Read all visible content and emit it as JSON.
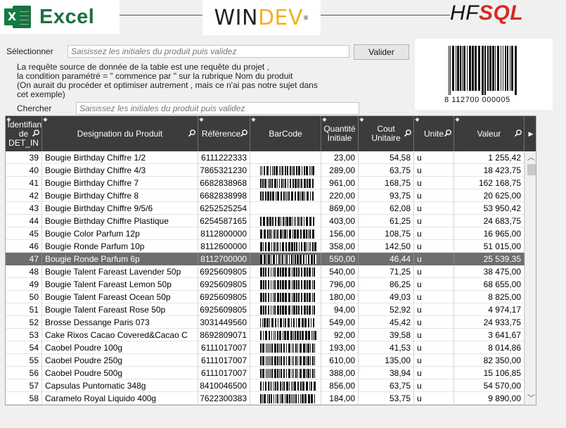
{
  "logos": {
    "excel": "Excel",
    "excel_icon_letter": "X",
    "windev_a": "WIN",
    "windev_b": "DEV",
    "hfsql_a": "HF",
    "hfsql_b": "SQL"
  },
  "form": {
    "select_label": "Sélectionner",
    "select_placeholder": "Saisissez les initiales du produit puis validez",
    "validate_label": "Valider",
    "description": [
      "La requête source de donnée de la table est une requête du projet ,",
      "la condition paramétré = \" commence par \" sur la rubrique Nom du produit",
      "(On aurait du procéder et optimiser autrement , mais ce n'ai pas notre sujet dans",
      "cet exemple)"
    ],
    "search_label": "Chercher",
    "search_placeholder": "Saisissez les initiales du produit puis validez"
  },
  "barcode_preview": {
    "number": "8 112700 000005"
  },
  "table": {
    "headers": {
      "id": "Identifiant de DET_IN",
      "designation": "Designation du Produit",
      "reference": "Référence",
      "barcode": "BarCode",
      "qty": "Quantité Initiale",
      "cost": "Cout Unitaire",
      "unit": "Unite",
      "value": "Valeur"
    },
    "selected_id": "47",
    "rows": [
      {
        "id": "39",
        "designation": "Bougie Birthday Chiffre 1/2",
        "reference": "6111222333",
        "barcode": false,
        "qty": "23,00",
        "cost": "54,58",
        "unit": "u",
        "value": "1 255,42"
      },
      {
        "id": "40",
        "designation": "Bougie Birthday Chiffre 4/3",
        "reference": "7865321230",
        "barcode": true,
        "qty": "289,00",
        "cost": "63,75",
        "unit": "u",
        "value": "18 423,75"
      },
      {
        "id": "41",
        "designation": "Bougie Birthday Chiffre 7",
        "reference": "6682838968",
        "barcode": true,
        "qty": "961,00",
        "cost": "168,75",
        "unit": "u",
        "value": "162 168,75"
      },
      {
        "id": "42",
        "designation": "Bougie Birthday Chiffre 8",
        "reference": "6682838998",
        "barcode": true,
        "qty": "220,00",
        "cost": "93,75",
        "unit": "u",
        "value": "20 625,00"
      },
      {
        "id": "43",
        "designation": "Bougie Birthday Chiffre 9/5/6",
        "reference": "6252525254",
        "barcode": false,
        "qty": "869,00",
        "cost": "62,08",
        "unit": "u",
        "value": "53 950,42"
      },
      {
        "id": "44",
        "designation": "Bougie Birthday Chiffre Plastique",
        "reference": "6254587165",
        "barcode": true,
        "qty": "403,00",
        "cost": "61,25",
        "unit": "u",
        "value": "24 683,75"
      },
      {
        "id": "45",
        "designation": "Bougie Color Parfum 12p",
        "reference": "8112800000",
        "barcode": true,
        "qty": "156,00",
        "cost": "108,75",
        "unit": "u",
        "value": "16 965,00"
      },
      {
        "id": "46",
        "designation": "Bougie Ronde Parfum 10p",
        "reference": "8112600000",
        "barcode": true,
        "qty": "358,00",
        "cost": "142,50",
        "unit": "u",
        "value": "51 015,00"
      },
      {
        "id": "47",
        "designation": "Bougie Ronde Parfum 6p",
        "reference": "8112700000",
        "barcode": true,
        "qty": "550,00",
        "cost": "46,44",
        "unit": "u",
        "value": "25 539,35"
      },
      {
        "id": "48",
        "designation": "Bougie Talent Fareast Lavender 50p",
        "reference": "6925609805",
        "barcode": true,
        "qty": "540,00",
        "cost": "71,25",
        "unit": "u",
        "value": "38 475,00"
      },
      {
        "id": "49",
        "designation": "Bougie Talent Fareast Lemon 50p",
        "reference": "6925609805",
        "barcode": true,
        "qty": "796,00",
        "cost": "86,25",
        "unit": "u",
        "value": "68 655,00"
      },
      {
        "id": "50",
        "designation": "Bougie Talent Fareast Ocean 50p",
        "reference": "6925609805",
        "barcode": true,
        "qty": "180,00",
        "cost": "49,03",
        "unit": "u",
        "value": "8 825,00"
      },
      {
        "id": "51",
        "designation": "Bougie Talent Fareast Rose 50p",
        "reference": "6925609805",
        "barcode": true,
        "qty": "94,00",
        "cost": "52,92",
        "unit": "u",
        "value": "4 974,17"
      },
      {
        "id": "52",
        "designation": "Brosse Dessange Paris 073",
        "reference": "3031449560",
        "barcode": true,
        "qty": "549,00",
        "cost": "45,42",
        "unit": "u",
        "value": "24 933,75"
      },
      {
        "id": "53",
        "designation": "Cake Rixos Cacao Covered&Cacao C",
        "reference": "8692809071",
        "barcode": true,
        "qty": "92,00",
        "cost": "39,58",
        "unit": "u",
        "value": "3 641,67"
      },
      {
        "id": "54",
        "designation": "Caobel Poudre 100g",
        "reference": "6111017007",
        "barcode": true,
        "qty": "193,00",
        "cost": "41,53",
        "unit": "u",
        "value": "8 014,86"
      },
      {
        "id": "55",
        "designation": "Caobel Poudre 250g",
        "reference": "6111017007",
        "barcode": true,
        "qty": "610,00",
        "cost": "135,00",
        "unit": "u",
        "value": "82 350,00"
      },
      {
        "id": "56",
        "designation": "Caobel Poudre 500g",
        "reference": "6111017007",
        "barcode": true,
        "qty": "388,00",
        "cost": "38,94",
        "unit": "u",
        "value": "15 106,85"
      },
      {
        "id": "57",
        "designation": "Capsulas Puntomatic 348g",
        "reference": "8410046500",
        "barcode": true,
        "qty": "856,00",
        "cost": "63,75",
        "unit": "u",
        "value": "54 570,00"
      },
      {
        "id": "58",
        "designation": "Caramelo Royal Liquido 400g",
        "reference": "7622300383",
        "barcode": true,
        "qty": "184,00",
        "cost": "53,75",
        "unit": "u",
        "value": "9 890,00"
      }
    ]
  }
}
